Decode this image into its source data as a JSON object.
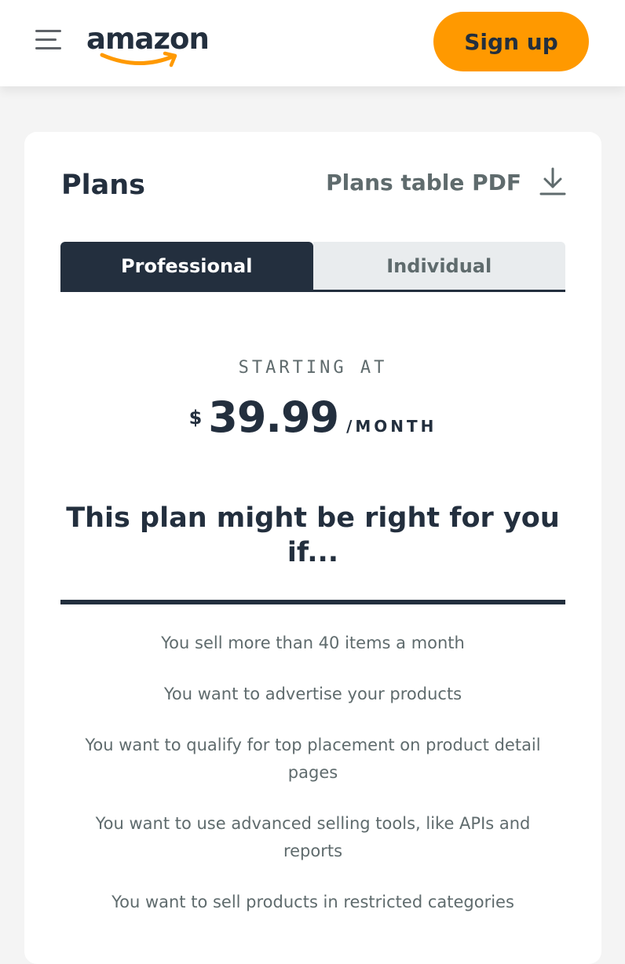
{
  "header": {
    "logo_text": "amazon",
    "signup_label": "Sign up",
    "accent_color": "#ff9900"
  },
  "plans": {
    "title": "Plans",
    "pdf_link_label": "Plans table PDF",
    "tabs": [
      {
        "label": "Professional",
        "active": true
      },
      {
        "label": "Individual",
        "active": false
      }
    ],
    "pricing": {
      "starting_label": "STARTING AT",
      "currency": "$",
      "amount": "39.99",
      "period": "/MONTH"
    },
    "heading": "This plan might be right for you if...",
    "criteria": [
      "You sell more than 40 items a month",
      "You want to advertise your products",
      "You want to qualify for top placement on product detail pages",
      "You want to use advanced selling tools, like APIs and reports",
      "You want to sell products in restricted categories"
    ]
  }
}
